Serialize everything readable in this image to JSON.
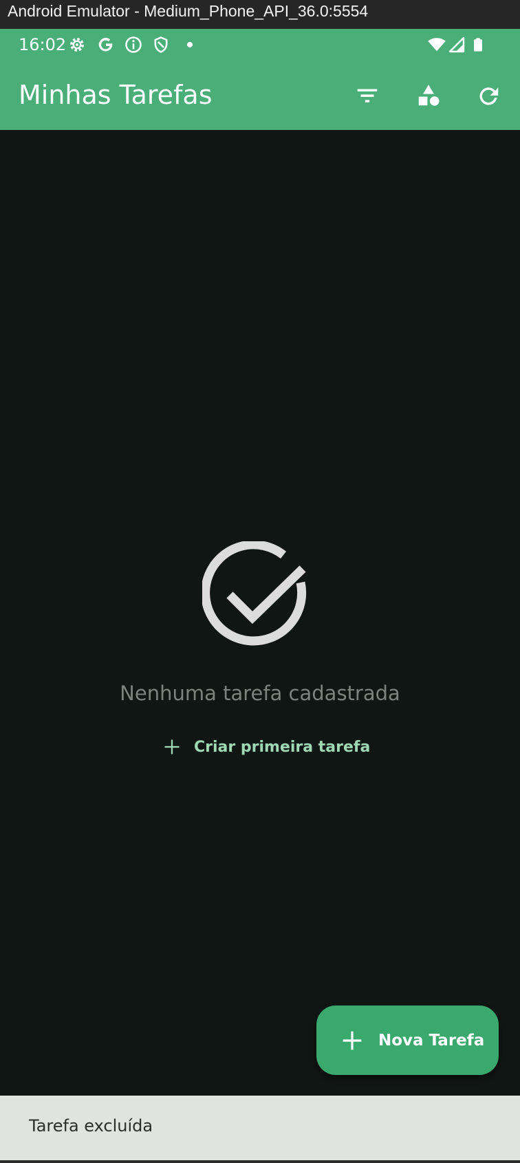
{
  "window": {
    "title": "Android Emulator - Medium_Phone_API_36.0:5554"
  },
  "status_bar": {
    "time": "16:02",
    "left_icons": [
      "gear-icon",
      "google-icon",
      "info-icon",
      "shield-icon",
      "dot-icon"
    ],
    "right_icons": [
      "wifi-icon",
      "cell-signal-icon",
      "battery-icon"
    ]
  },
  "app_bar": {
    "title": "Minhas Tarefas",
    "actions": [
      "filter-icon",
      "shapes-icon",
      "refresh-icon"
    ]
  },
  "empty_state": {
    "icon": "check-circle-icon",
    "message": "Nenhuma tarefa cadastrada",
    "action_label": "Criar primeira tarefa",
    "action_icon": "plus-icon"
  },
  "fab": {
    "label": "Nova Tarefa",
    "icon": "plus-icon"
  },
  "snackbar": {
    "message": "Tarefa excluída"
  },
  "colors": {
    "primary": "#49ae78",
    "fab": "#3aa96e",
    "background": "#101613",
    "accent_text": "#9fd8b5",
    "snackbar_bg": "#dfe4de"
  }
}
